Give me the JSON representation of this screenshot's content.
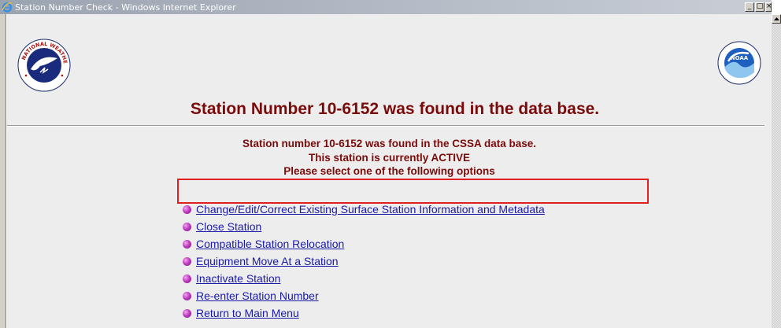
{
  "window": {
    "title": "Station Number Check - Windows Internet Explorer",
    "minimize": "_",
    "maximize": "□",
    "close": "×"
  },
  "page": {
    "heading": "Station Number 10-6152 was found in the data base.",
    "info_lines": [
      "Station number 10-6152 was found in the CSSA data base.",
      "This station is currently ACTIVE",
      "Please select one of the following options"
    ],
    "options": [
      "Change/Edit/Correct Existing Surface Station Information and Metadata",
      "Close Station",
      "Compatible Station Relocation",
      "Equipment Move At a Station",
      "Inactivate Station",
      "Re-enter Station Number",
      "Return to Main Menu"
    ]
  },
  "logos": {
    "nws_text": "NATIONAL WEATHER SERVICE",
    "noaa_text": "NOAA"
  },
  "colors": {
    "heading": "#7a0b0b",
    "link": "#1a1aa8",
    "highlight": "#e02020",
    "background": "#ededed"
  }
}
